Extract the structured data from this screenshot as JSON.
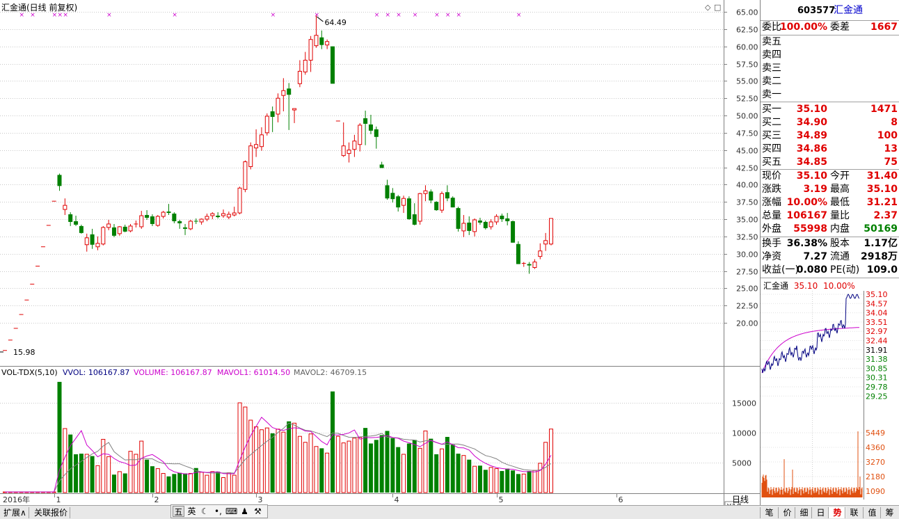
{
  "chart_title": "汇金通(日线 前复权)",
  "price_axis": [
    "65.00",
    "62.50",
    "60.00",
    "57.50",
    "55.00",
    "52.50",
    "50.00",
    "47.50",
    "45.00",
    "42.50",
    "40.00",
    "37.50",
    "35.00",
    "32.50",
    "30.00",
    "27.50",
    "25.00",
    "22.50",
    "20.00"
  ],
  "high_marker": "64.49",
  "low_marker": "15.98",
  "vol_indicator": {
    "name": "VOL-TDX(5,10)",
    "vvol": "VVOL: 106167.87",
    "volume": "VOLUME: 106167.87",
    "mavol1": "MAVOL1: 61014.50",
    "mavol2": "MAVOL2: 46709.15"
  },
  "vol_axis": [
    "15000",
    "10000",
    "5000"
  ],
  "vol_unit": "X10",
  "date_axis": [
    "2016年",
    "1",
    "2",
    "3",
    "4",
    "5",
    "6"
  ],
  "period_label": "日线",
  "bottom_tabs": [
    "扩展∧",
    "关联报价"
  ],
  "ime_bar": {
    "label_five": "五",
    "label_en": "英"
  },
  "right_tabs": [
    "笔",
    "价",
    "细",
    "日",
    "势",
    "联",
    "值",
    "筹"
  ],
  "quote": {
    "code": "603577",
    "name": "汇金通",
    "weibi_label": "委比",
    "weibi": "100.00%",
    "weicha_label": "委差",
    "weicha": "1667",
    "asks": [
      "卖五",
      "卖四",
      "卖三",
      "卖二",
      "卖一"
    ],
    "bids": [
      {
        "label": "买一",
        "price": "35.10",
        "vol": "1471"
      },
      {
        "label": "买二",
        "price": "34.90",
        "vol": "8"
      },
      {
        "label": "买三",
        "price": "34.89",
        "vol": "100"
      },
      {
        "label": "买四",
        "price": "34.86",
        "vol": "13"
      },
      {
        "label": "买五",
        "price": "34.85",
        "vol": "75"
      }
    ],
    "stats": [
      {
        "l1": "现价",
        "v1": "35.10",
        "l2": "今开",
        "v2": "31.40"
      },
      {
        "l1": "涨跌",
        "v1": "3.19",
        "l2": "最高",
        "v2": "35.10"
      },
      {
        "l1": "涨幅",
        "v1": "10.00%",
        "l2": "最低",
        "v2": "31.21"
      },
      {
        "l1": "总量",
        "v1": "106167",
        "l2": "量比",
        "v2": "2.37"
      },
      {
        "l1": "外盘",
        "v1": "55998",
        "l2": "内盘",
        "v2": "50169"
      }
    ],
    "stats2": [
      {
        "l1": "换手",
        "v1": "36.38%",
        "l2": "股本",
        "v2": "1.17亿"
      },
      {
        "l1": "净资",
        "v1": "7.27",
        "l2": "流通",
        "v2": "2918万"
      },
      {
        "l1": "收益(一)",
        "v1": "0.080",
        "l2": "PE(动)",
        "v2": "109.0"
      }
    ]
  },
  "intraday": {
    "name": "汇金通",
    "price": "35.10",
    "pct": "10.00%",
    "price_axis_red": [
      "35.10",
      "34.57",
      "34.04",
      "33.51",
      "32.97",
      "32.44"
    ],
    "mid": "31.91",
    "price_axis_green": [
      "31.38",
      "30.85",
      "30.31",
      "29.78",
      "29.25"
    ],
    "vol_axis": [
      "5449",
      "4360",
      "3270",
      "2180",
      "1090"
    ]
  },
  "colors": {
    "up": "#e00000",
    "down": "#008000",
    "ma1": "#cc00cc",
    "ma2": "#808080",
    "signal": "#cc00cc",
    "intraday_line": "#000080",
    "intraday_avg": "#cc00cc",
    "intraday_vol": "#e05010"
  },
  "chart_data": [
    {
      "type": "candlestick",
      "title": "汇金通(日线 前复权)",
      "ylim": [
        15.98,
        65.0
      ],
      "xlabel": "",
      "ylabel": "",
      "x_ticks": [
        "2016年",
        "1",
        "2",
        "3",
        "4",
        "5",
        "6"
      ],
      "series": [
        {
          "name": "ohlc",
          "values": [
            [
              16.0,
              16.0,
              15.98,
              16.0
            ],
            [
              17.5,
              17.5,
              17.5,
              17.5
            ],
            [
              19.2,
              19.2,
              19.2,
              19.2
            ],
            [
              21.2,
              21.2,
              21.2,
              21.2
            ],
            [
              23.3,
              23.3,
              23.3,
              23.3
            ],
            [
              25.6,
              25.6,
              25.6,
              25.6
            ],
            [
              28.2,
              28.2,
              28.2,
              28.2
            ],
            [
              31.0,
              31.0,
              31.0,
              31.0
            ],
            [
              34.1,
              34.1,
              34.1,
              34.1
            ],
            [
              37.6,
              37.6,
              37.6,
              37.6
            ],
            [
              41.4,
              41.6,
              39.1,
              39.8
            ],
            [
              36.4,
              38.0,
              35.6,
              37.0
            ],
            [
              35.7,
              36.0,
              34.0,
              34.6
            ],
            [
              34.7,
              35.5,
              34.0,
              34.2
            ],
            [
              34.0,
              34.2,
              32.9,
              33.0
            ],
            [
              31.3,
              32.9,
              30.3,
              32.3
            ],
            [
              32.8,
              33.6,
              30.7,
              31.3
            ],
            [
              31.0,
              32.5,
              30.5,
              31.5
            ],
            [
              31.4,
              34.0,
              31.2,
              33.8
            ],
            [
              33.8,
              34.9,
              33.4,
              34.3
            ],
            [
              33.8,
              34.3,
              32.4,
              32.6
            ],
            [
              32.9,
              34.0,
              32.6,
              33.9
            ],
            [
              33.9,
              34.2,
              33.1,
              33.2
            ],
            [
              33.3,
              34.3,
              33.1,
              34.0
            ],
            [
              34.2,
              34.8,
              33.8,
              34.3
            ],
            [
              33.9,
              36.2,
              33.6,
              35.5
            ],
            [
              35.6,
              36.3,
              34.9,
              35.2
            ],
            [
              35.4,
              35.7,
              34.0,
              34.3
            ],
            [
              34.1,
              35.6,
              33.9,
              35.4
            ],
            [
              35.4,
              36.2,
              35.1,
              36.0
            ],
            [
              36.1,
              37.2,
              35.6,
              35.9
            ],
            [
              35.8,
              36.0,
              34.4,
              34.7
            ],
            [
              34.7,
              34.9,
              33.6,
              34.4
            ],
            [
              33.8,
              34.3,
              32.7,
              33.6
            ],
            [
              33.6,
              34.9,
              33.4,
              34.7
            ],
            [
              34.7,
              35.1,
              34.3,
              34.6
            ],
            [
              34.6,
              35.1,
              34.2,
              35.0
            ],
            [
              35.0,
              35.8,
              34.7,
              35.4
            ],
            [
              35.5,
              36.0,
              35.0,
              35.8
            ],
            [
              35.5,
              36.0,
              35.1,
              35.3
            ],
            [
              35.5,
              36.4,
              35.2,
              35.8
            ],
            [
              35.3,
              36.1,
              35.0,
              35.7
            ],
            [
              35.6,
              36.8,
              35.4,
              35.9
            ],
            [
              35.9,
              39.7,
              35.7,
              39.5
            ],
            [
              39.3,
              43.5,
              38.9,
              43.3
            ],
            [
              42.6,
              46.1,
              42.2,
              45.6
            ],
            [
              45.3,
              48.0,
              44.0,
              45.8
            ],
            [
              45.5,
              48.3,
              44.9,
              47.2
            ],
            [
              47.5,
              50.3,
              47.1,
              49.9
            ],
            [
              50.6,
              51.3,
              47.6,
              49.8
            ],
            [
              50.2,
              53.2,
              49.0,
              52.5
            ],
            [
              52.9,
              55.4,
              50.6,
              53.6
            ],
            [
              53.9,
              54.7,
              47.9,
              53.0
            ],
            [
              50.8,
              51.0,
              48.9,
              51.0
            ],
            [
              54.6,
              58.0,
              54.1,
              56.4
            ],
            [
              56.3,
              59.2,
              55.9,
              58.0
            ],
            [
              58.0,
              61.5,
              56.3,
              61.0
            ],
            [
              60.1,
              64.49,
              59.8,
              61.6
            ],
            [
              61.3,
              62.3,
              59.6,
              60.2
            ],
            [
              60.2,
              61.0,
              59.6,
              60.7
            ],
            [
              60.0,
              60.0,
              54.6,
              54.6
            ],
            [
              49.2,
              49.2,
              49.2,
              49.2
            ],
            [
              44.2,
              49.0,
              44.0,
              45.6
            ],
            [
              44.5,
              46.1,
              43.2,
              45.0
            ],
            [
              45.1,
              47.2,
              44.0,
              46.3
            ],
            [
              45.8,
              48.9,
              44.8,
              48.6
            ],
            [
              49.6,
              50.7,
              45.7,
              48.8
            ],
            [
              48.7,
              50.1,
              47.3,
              47.8
            ],
            [
              48.0,
              48.4,
              45.2,
              46.9
            ],
            [
              42.9,
              43.3,
              42.4,
              42.4
            ],
            [
              39.9,
              40.7,
              37.8,
              38.0
            ],
            [
              38.8,
              39.5,
              37.4,
              37.9
            ],
            [
              38.3,
              38.5,
              36.1,
              36.7
            ],
            [
              37.0,
              38.4,
              35.9,
              38.0
            ],
            [
              38.0,
              38.3,
              34.9,
              35.0
            ],
            [
              35.7,
              37.3,
              34.1,
              34.2
            ],
            [
              34.7,
              38.8,
              34.2,
              38.7
            ],
            [
              38.7,
              39.9,
              37.6,
              39.1
            ],
            [
              39.0,
              39.3,
              37.3,
              37.7
            ],
            [
              37.5,
              37.6,
              36.2,
              36.3
            ],
            [
              36.3,
              39.0,
              35.9,
              38.7
            ],
            [
              38.9,
              39.9,
              37.6,
              38.0
            ],
            [
              38.1,
              38.3,
              36.7,
              36.7
            ],
            [
              36.6,
              36.8,
              33.2,
              33.6
            ],
            [
              33.3,
              35.6,
              32.4,
              34.4
            ],
            [
              34.5,
              35.4,
              32.7,
              33.3
            ],
            [
              33.2,
              35.1,
              32.5,
              34.9
            ],
            [
              34.8,
              35.2,
              34.2,
              34.5
            ],
            [
              34.6,
              34.8,
              33.5,
              33.7
            ],
            [
              33.9,
              35.0,
              33.5,
              34.6
            ],
            [
              34.6,
              35.7,
              34.2,
              35.4
            ],
            [
              35.5,
              35.8,
              34.6,
              35.0
            ],
            [
              35.1,
              35.9,
              34.1,
              34.7
            ],
            [
              34.7,
              34.8,
              31.6,
              31.6
            ],
            [
              31.4,
              31.8,
              28.5,
              28.5
            ],
            [
              28.5,
              28.8,
              28.1,
              28.6
            ],
            [
              28.5,
              28.8,
              27.1,
              28.3
            ],
            [
              28.0,
              29.2,
              27.8,
              28.8
            ],
            [
              29.6,
              31.5,
              29.2,
              30.4
            ],
            [
              31.4,
              33.0,
              30.4,
              31.9
            ],
            [
              31.4,
              35.1,
              31.21,
              35.1
            ]
          ]
        }
      ]
    },
    {
      "type": "bar",
      "title": "VOL-TDX(5,10)",
      "ylim": [
        0,
        18000
      ],
      "series": [
        {
          "name": "VOLUME",
          "values": [
            100,
            100,
            100,
            100,
            100,
            100,
            100,
            100,
            100,
            100,
            18500,
            10700,
            9700,
            6400,
            6500,
            6400,
            6100,
            4500,
            8900,
            6000,
            3000,
            3500,
            3200,
            6900,
            6400,
            8600,
            5500,
            4400,
            4000,
            3200,
            2700,
            3100,
            3300,
            3200,
            3200,
            4100,
            3400,
            2900,
            3500,
            3500,
            2500,
            3300,
            2900,
            15000,
            14300,
            12100,
            11000,
            10500,
            10800,
            9900,
            10600,
            10100,
            11900,
            11600,
            9400,
            8400,
            9800,
            7700,
            7400,
            6600,
            16900,
            9400,
            8300,
            8600,
            9100,
            9200,
            10800,
            8200,
            8800,
            9600,
            10300,
            9100,
            7600,
            6400,
            8200,
            8800,
            7400,
            10300,
            9000,
            6400,
            7300,
            9300,
            8000,
            6500,
            6200,
            5500,
            4400,
            4500,
            3800,
            4200,
            4000,
            3600,
            4000,
            3700,
            3100,
            3100,
            3600,
            3700,
            4900,
            8400,
            10616.787
          ]
        },
        {
          "name": "MAVOL1",
          "values": []
        },
        {
          "name": "MAVOL2",
          "values": []
        }
      ]
    }
  ]
}
